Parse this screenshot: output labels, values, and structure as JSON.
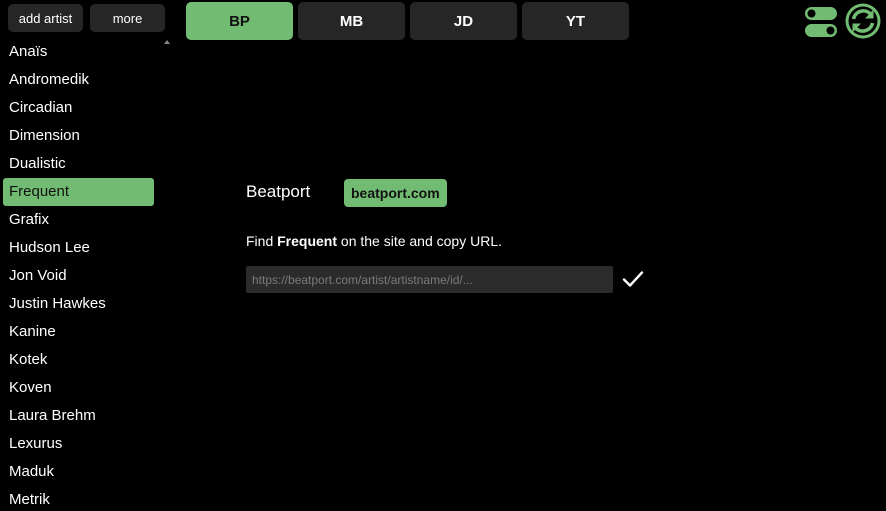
{
  "header": {
    "add_artist_label": "add artist",
    "more_label": "more",
    "tabs": [
      {
        "label": "BP",
        "active": true
      },
      {
        "label": "MB",
        "active": false
      },
      {
        "label": "JD",
        "active": false
      },
      {
        "label": "YT",
        "active": false
      }
    ]
  },
  "sidebar": {
    "artists": [
      "Anaïs",
      "Andromedik",
      "Circadian",
      "Dimension",
      "Dualistic",
      "Frequent",
      "Grafix",
      "Hudson Lee",
      "Jon Void",
      "Justin Hawkes",
      "Kanine",
      "Kotek",
      "Koven",
      "Laura Brehm",
      "Lexurus",
      "Maduk",
      "Metrik"
    ],
    "selected": "Frequent"
  },
  "main": {
    "service_name": "Beatport",
    "site_label": "beatport.com",
    "instruction_prefix": "Find",
    "artist_name": "Frequent",
    "instruction_suffix": "on the site and copy URL.",
    "url_value": "",
    "url_placeholder": "https://beatport.com/artist/artistname/id/..."
  },
  "icons": {
    "toggle": "toggle-settings-icon",
    "refresh": "refresh-icon",
    "confirm": "checkmark-icon",
    "scroll": "scroll-up-arrow-icon"
  },
  "colors": {
    "accent": "#72bb72",
    "background": "#000000",
    "button": "#262626",
    "input": "#2b2b2b"
  }
}
